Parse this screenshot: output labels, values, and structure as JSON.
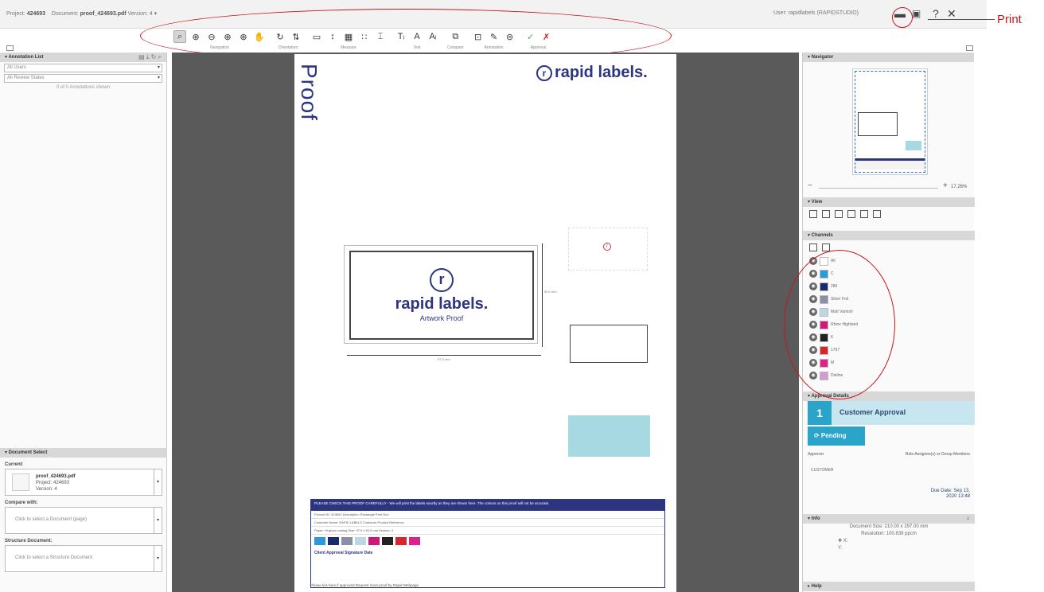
{
  "header": {
    "project_label": "Project:",
    "project_value": "424693",
    "document_label": "Document:",
    "document_value": "proof_424693.pdf",
    "version": "Version: 4 ▾",
    "user": "User: rapidlabels (RAPIDSTUDIO)",
    "window_controls": [
      "?",
      "✕"
    ]
  },
  "annotation_callout": "Print",
  "toolbar": {
    "groups": [
      {
        "label": "Navigation",
        "icons": [
          "⌕",
          "⊕",
          "⊖",
          "⊕",
          "⊕",
          "✋"
        ]
      },
      {
        "label": "Orientation",
        "icons": [
          "↻",
          "⇅"
        ]
      },
      {
        "label": "Measure",
        "icons": [
          "▭",
          "↕",
          "▦",
          "∷",
          "⌶"
        ]
      },
      {
        "label": "Text",
        "icons": [
          "Tᵢ",
          "A",
          "Aᵢ"
        ]
      },
      {
        "label": "Compare",
        "icons": [
          "⧉"
        ]
      },
      {
        "label": "Annotation",
        "icons": [
          "⊡",
          "✎",
          "⊜"
        ]
      },
      {
        "label": "Approval",
        "icons": [
          "✓",
          "✗"
        ]
      }
    ]
  },
  "left": {
    "annotation_title": "▾ Annotation List",
    "annotation_tools": "▤ ⤓ ↻ ⌕",
    "users_select": "All Users",
    "states_select": "All Review States",
    "shown_count": "0 of 0 Annotations shown",
    "doc_title": "▾ Document Select",
    "current_label": "Current:",
    "current_doc": "proof_424693.pdf",
    "current_project": "Project: 424693",
    "current_version": "Version: 4",
    "compare_label": "Compare with:",
    "compare_placeholder": "Click to select a Document (page)",
    "structure_label": "Structure Document:",
    "structure_placeholder": "Click to select a Structure Document"
  },
  "canvas": {
    "proof_word": "Proof",
    "logo_text": "rapid labels.",
    "label_brand": "rapid labels.",
    "label_sub": "Artwork Proof",
    "dim_h": "97.0 mm",
    "dim_v": "50.0 mm",
    "strip_header": "PLEASE CHECK THIS PROOF CAREFULLY - We will print the labels exactly as they are shown here. The colours on this proof will not be accurate.",
    "strip_row1": "Product ID: 424693   Description: Rectangle Print Run",
    "strip_row2": "Customer Name: RAPID LABELS   Customer Product Reference",
    "strip_row3": "Paper: Hi-gloss coating   Size: 97.0 x 50.0 mm   Version: 4",
    "strip_approval": "Client Approval  Signature                          Date",
    "footer_text": "Please tick here if approved  Request more proof by Rapid Webpage"
  },
  "right": {
    "navigator_title": "▾ Navigator",
    "zoom_value": "17.26%",
    "view_title": "▾ View",
    "channels_title": "▾ Channels",
    "channels": [
      {
        "name": "All",
        "color": "#ffffff"
      },
      {
        "name": "C",
        "color": "#2a9ad8"
      },
      {
        "name": "280",
        "color": "#1b2a6b"
      },
      {
        "name": "Silver Foil",
        "color": "#8a8fa6"
      },
      {
        "name": "Matt Varnish",
        "color": "#bcd6e2"
      },
      {
        "name": "Rhine Highland",
        "color": "#d1187a"
      },
      {
        "name": "K",
        "color": "#222222"
      },
      {
        "name": "1797",
        "color": "#d8242a"
      },
      {
        "name": "M",
        "color": "#e0208c"
      },
      {
        "name": "Dieline",
        "color": "#d79acf"
      }
    ],
    "approval_title": "▾ Approval Details",
    "step_number": "1",
    "step_title": "Customer Approval",
    "pending_label": "⟳ Pending",
    "approver_label": "Approver",
    "role_label": "Role Assignee(s) or Group Members",
    "customer": "CUSTOMER",
    "due_label": "Due Date: Sep 13,",
    "due_time": "2020 13:48",
    "info_title": "▾ Info",
    "doc_size": "Document Size: 210.00 x 297.00 mm",
    "resolution": "Resolution: 100.839 ppcm",
    "x_label": "X:",
    "y_label": "Y:",
    "help_title": "▸ Help"
  },
  "colors": {
    "accent": "#2ba4c9",
    "brand_navy": "#2d3580",
    "annotation_red": "#c8161d",
    "canvas_bg": "#5a5a5a"
  }
}
